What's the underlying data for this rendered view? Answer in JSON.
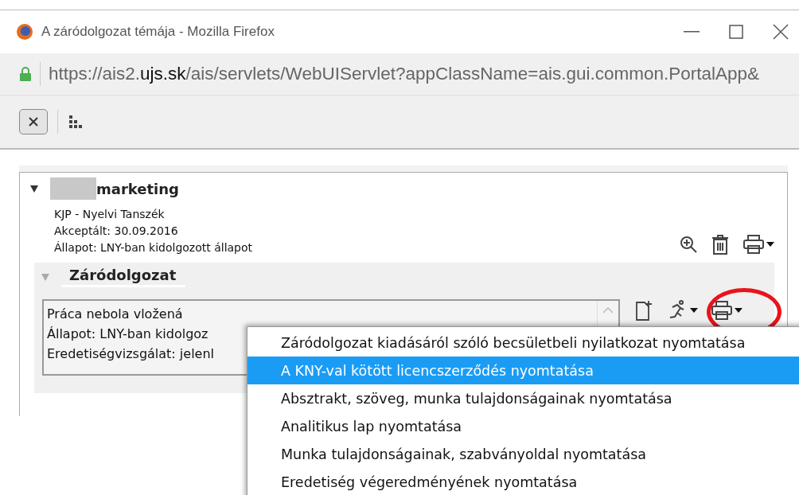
{
  "window": {
    "title": "A záródolgozat témája - Mozilla Firefox"
  },
  "address_bar": {
    "scheme": "https://ais2.",
    "host": "ujs.sk",
    "path": "/ais/servlets/WebUIServlet?appClassName=ais.gui.common.PortalApp&"
  },
  "thesis": {
    "title": "marketing",
    "expanded": true,
    "lines": [
      "KJP - Nyelvi Tanszék",
      "Akceptált: 30.09.2016",
      "Állapot: LNY-ban kidolgozott állapot"
    ],
    "section": {
      "title": "Záródolgozat",
      "expanded": true,
      "lines": [
        "Práca nebola vložená",
        "Állapot: LNY-ban kidolgoz",
        "Eredetiségvizsgálat: jelenl"
      ]
    }
  },
  "print_menu": {
    "items": [
      {
        "label": "Záródolgozat kiadásáról szóló becsületbeli nyilatkozat nyomtatása",
        "selected": false
      },
      {
        "label": "A KNY-val kötött licencszerződés nyomtatása",
        "selected": true
      },
      {
        "label": "Absztrakt, szöveg, munka tulajdonságainak nyomtatása",
        "selected": false
      },
      {
        "label": "Analitikus lap nyomtatása",
        "selected": false
      },
      {
        "label": "Munka tulajdonságainak, szabványoldal nyomtatása",
        "selected": false
      },
      {
        "label": "Eredetiség végeredményének nyomtatása",
        "selected": false
      }
    ]
  }
}
